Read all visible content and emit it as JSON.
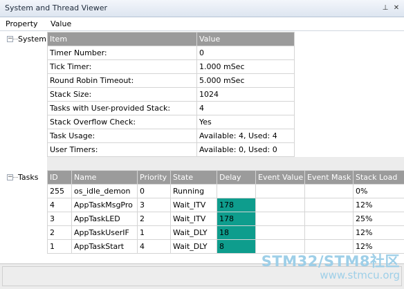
{
  "window": {
    "title": "System and Thread Viewer",
    "pin_icon": "pin-icon",
    "close_icon": "close-icon",
    "pin_glyph": "⊥",
    "close_glyph": "✕"
  },
  "columns": {
    "property": "Property",
    "value": "Value"
  },
  "tree": {
    "system_label": "System",
    "tasks_label": "Tasks",
    "expander_glyph": "−"
  },
  "system_table": {
    "headers": [
      "Item",
      "Value"
    ],
    "rows": [
      [
        "Timer Number:",
        "0"
      ],
      [
        "Tick Timer:",
        "1.000 mSec"
      ],
      [
        "Round Robin Timeout:",
        "5.000 mSec"
      ],
      [
        "Stack Size:",
        "1024"
      ],
      [
        "Tasks with User-provided Stack:",
        "4"
      ],
      [
        "Stack Overflow Check:",
        "Yes"
      ],
      [
        "Task Usage:",
        "Available: 4, Used: 4"
      ],
      [
        "User Timers:",
        "Available: 0, Used: 0"
      ]
    ]
  },
  "tasks_table": {
    "headers": [
      "ID",
      "Name",
      "Priority",
      "State",
      "Delay",
      "Event Value",
      "Event Mask",
      "Stack Load"
    ],
    "rows": [
      [
        "255",
        "os_idle_demon",
        "0",
        "Running",
        "",
        "",
        "",
        "0%"
      ],
      [
        "4",
        "AppTaskMsgPro",
        "3",
        "Wait_ITV",
        "178",
        "",
        "",
        "12%"
      ],
      [
        "3",
        "AppTaskLED",
        "2",
        "Wait_ITV",
        "178",
        "",
        "",
        "25%"
      ],
      [
        "2",
        "AppTaskUserIF",
        "1",
        "Wait_DLY",
        "18",
        "",
        "",
        "12%"
      ],
      [
        "1",
        "AppTaskStart",
        "4",
        "Wait_DLY",
        "8",
        "",
        "",
        "12%"
      ]
    ],
    "delay_highlight_color": "#0e9d8d"
  },
  "watermark": {
    "brand": "STM32/STM8社区",
    "url": "www.stmcu.org"
  }
}
